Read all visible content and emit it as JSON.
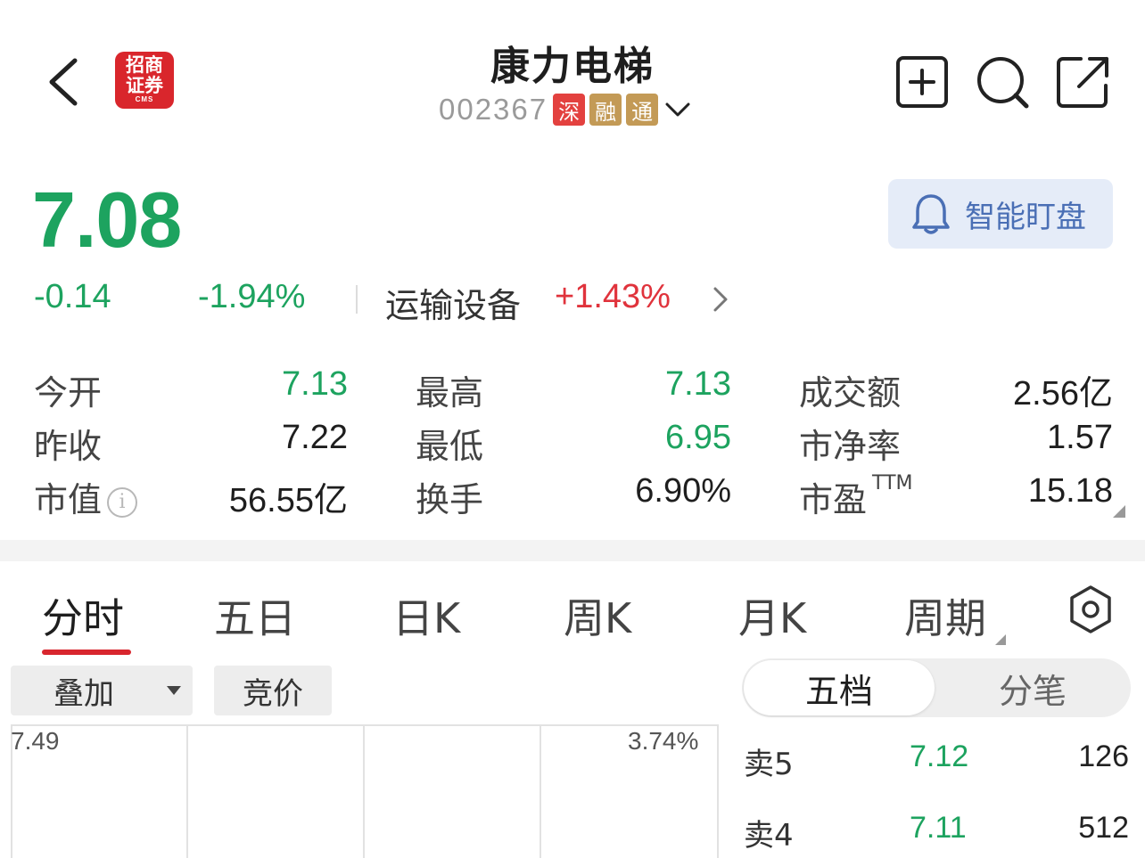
{
  "header": {
    "title": "康力电梯",
    "code": "002367",
    "tags": [
      "深",
      "融",
      "通"
    ],
    "logo_line1": "招商",
    "logo_line2": "证券",
    "logo_sub": "CMS",
    "icons": [
      "back-icon",
      "add-watchlist-icon",
      "search-icon",
      "share-icon"
    ]
  },
  "quote": {
    "price": "7.08",
    "change": "-0.14",
    "change_pct": "-1.94%",
    "sector": "运输设备",
    "sector_change": "+1.43%",
    "watch_button": "智能盯盘"
  },
  "stats": {
    "open_label": "今开",
    "open": "7.13",
    "high_label": "最高",
    "high": "7.13",
    "turnover_amt_label": "成交额",
    "turnover_amt": "2.56亿",
    "prev_close_label": "昨收",
    "prev_close": "7.22",
    "low_label": "最低",
    "low": "6.95",
    "pb_label": "市净率",
    "pb": "1.57",
    "mcap_label": "市值",
    "mcap": "56.55亿",
    "turnover_label": "换手",
    "turnover": "6.90%",
    "pe_label": "市盈",
    "pe_suffix": "TTM",
    "pe": "15.18"
  },
  "tabs": [
    "分时",
    "五日",
    "日K",
    "周K",
    "月K",
    "周期"
  ],
  "chart_controls": {
    "overlay": "叠加",
    "auction": "竞价",
    "seg_active": "五档",
    "seg_other": "分笔"
  },
  "chart_axis": {
    "top_price": "7.49",
    "top_pct": "3.74%"
  },
  "order_book": [
    {
      "label": "卖5",
      "price": "7.12",
      "volume": "126"
    },
    {
      "label": "卖4",
      "price": "7.11",
      "volume": "512"
    }
  ],
  "colors": {
    "up": "#e0333c",
    "down": "#1da35f",
    "accent": "#d8262e"
  }
}
